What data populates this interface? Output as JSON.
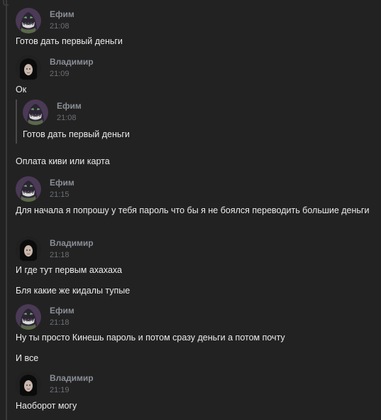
{
  "users": {
    "efim": {
      "name": "Ефим",
      "avatar_icon": "bape-shark-avatar"
    },
    "vladimir": {
      "name": "Владимир",
      "avatar_icon": "dark-hair-portrait-avatar"
    }
  },
  "messages": [
    {
      "author": "Ефим",
      "time": "21:08",
      "lines": [
        "Готов дать первый деньги"
      ]
    },
    {
      "author": "Владимир",
      "time": "21:09",
      "lines": [
        "Ок"
      ],
      "quote": {
        "author": "Ефим",
        "time": "21:08",
        "text": "Готов дать первый деньги"
      },
      "after_quote": [
        "Оплата киви или карта"
      ]
    },
    {
      "author": "Ефим",
      "time": "21:15",
      "lines": [
        "Для начала я попрошу у тебя пароль что бы я не боялся переводить большие деньги"
      ]
    },
    {
      "author": "Владимир",
      "time": "21:18",
      "lines": [
        "И где тут первым ахахаха",
        "Бля какие же кидалы тупые"
      ]
    },
    {
      "author": "Ефим",
      "time": "21:18",
      "lines": [
        "Ну ты просто Кинешь пароль и потом сразу деньги а потом почту",
        "И все"
      ]
    },
    {
      "author": "Владимир",
      "time": "21:19",
      "lines": [
        "Наоборот могу"
      ]
    }
  ],
  "colors": {
    "background": "#222222",
    "author": "#8a8f96",
    "timestamp": "#6b6f75",
    "text": "#ececec",
    "quote_bar": "#4a4a4a"
  }
}
